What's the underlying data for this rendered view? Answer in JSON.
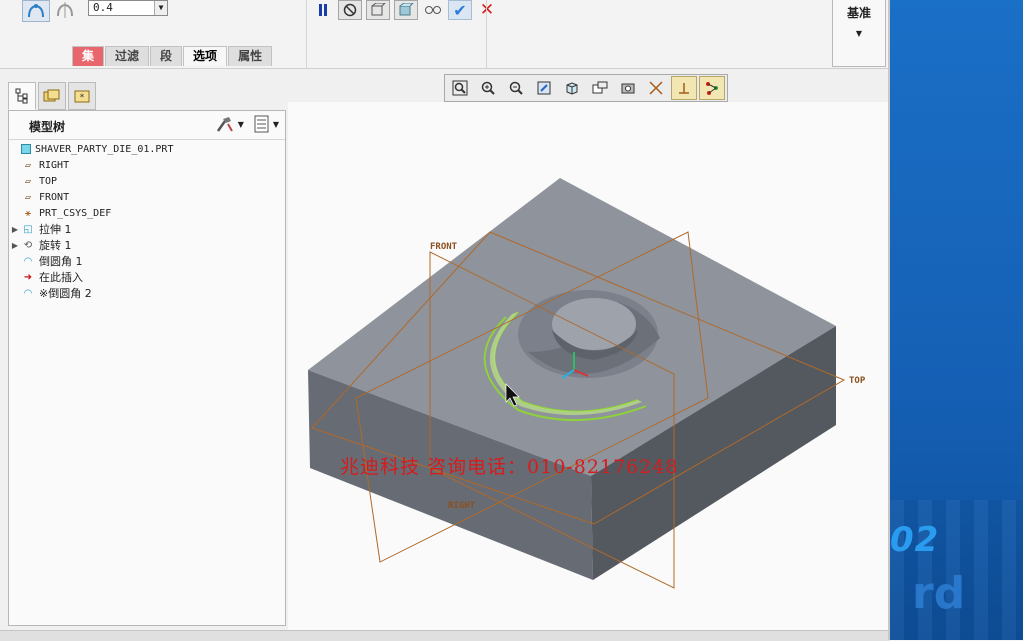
{
  "dashboard": {
    "thickness_value": "0.4",
    "tabs": [
      {
        "label": "集"
      },
      {
        "label": "过滤"
      },
      {
        "label": "段"
      },
      {
        "label": "选项"
      },
      {
        "label": "属性"
      }
    ],
    "datum_label": "基准"
  },
  "left_panel": {
    "title": "模型树",
    "tree": [
      {
        "label": "SHAVER_PARTY_DIE_01.PRT",
        "icon": "part-icon"
      },
      {
        "label": "RIGHT",
        "icon": "datum-plane-icon"
      },
      {
        "label": "TOP",
        "icon": "datum-plane-icon"
      },
      {
        "label": "FRONT",
        "icon": "datum-plane-icon"
      },
      {
        "label": "PRT_CSYS_DEF",
        "icon": "csys-icon"
      },
      {
        "label": "拉伸 1",
        "icon": "extrude-icon"
      },
      {
        "label": "旋转 1",
        "icon": "revolve-icon"
      },
      {
        "label": "倒圆角 1",
        "icon": "round-icon"
      },
      {
        "label": "在此插入",
        "icon": "insert-here-icon"
      },
      {
        "label": "※倒圆角 2",
        "icon": "round-icon"
      }
    ]
  },
  "viewport": {
    "datum_labels": {
      "front": "FRONT",
      "top": "TOP",
      "right": "RIGHT"
    },
    "watermark": "兆迪科技    咨询电话：010-82176248",
    "colors": {
      "face_top": "#8e939c",
      "face_left": "#666b73",
      "face_right": "#545960",
      "datum": "#b0692a",
      "highlight": "#8ed13a"
    }
  },
  "desktop": {
    "number_text": "02",
    "ghost_text": "rd"
  }
}
